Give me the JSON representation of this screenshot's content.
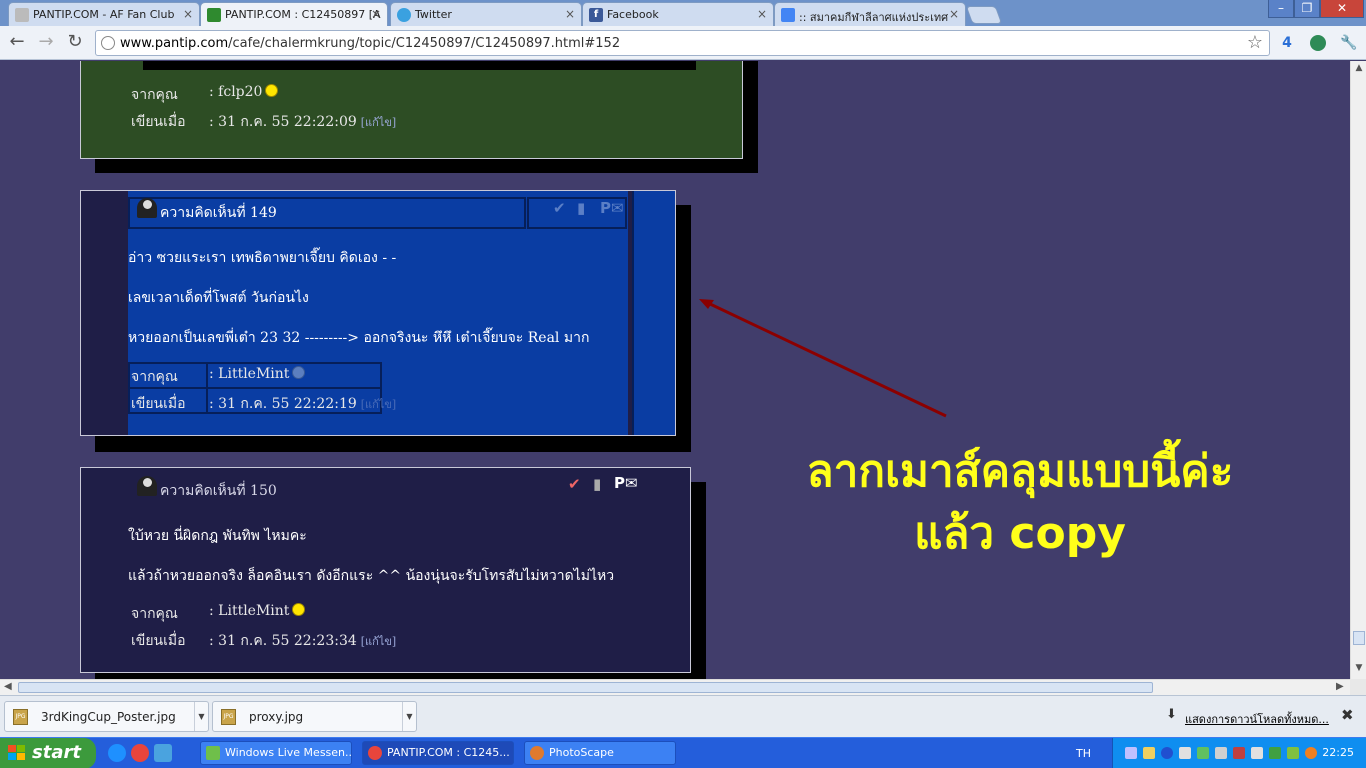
{
  "tabs": [
    {
      "title": "PANTIP.COM - AF Fan Club",
      "favicon": "pantip-icon"
    },
    {
      "title": "PANTIP.COM : C12450897 [A",
      "favicon": "pantip-cactus-icon"
    },
    {
      "title": "Twitter",
      "favicon": "twitter-icon"
    },
    {
      "title": "Facebook",
      "favicon": "facebook-icon"
    },
    {
      "title": ":: สมาคมกีฬาลีลาศแห่งประเทศ",
      "favicon": "google-icon"
    }
  ],
  "tab_close": "×",
  "window_controls": {
    "minimize": "–",
    "restore": "❐",
    "close": "✕"
  },
  "address_bar": {
    "domain": "www.pantip.com",
    "path": "/cafe/chalermkrung/topic/C12450897/C12450897.html#152"
  },
  "toolbar_icons": {
    "back": "←",
    "forward": "→",
    "reload": "↻",
    "ext_count": "4"
  },
  "post_prev": {
    "from_label": "จากคุณ",
    "from_value": ": fclp20",
    "written_label": "เขียนเมื่อ",
    "written_value": ": 31 ก.ค. 55 22:22:09",
    "edit": "[แก้ไข]"
  },
  "post_149": {
    "title": "ความคิดเห็นที่ 149",
    "lines": [
      "อ่าว ซวยแระเรา   เทพธิดาพยาเจี๊ยบ คิดเอง - -",
      "เลขเวลาเด็ดที่โพสต์ วันก่อนไง",
      "หวยออกเป็นเลขพี่เต๋า  23  32 ---------> ออกจริงนะ หึหึ เต๋าเจี๊ยบจะ Real มาก"
    ],
    "from_label": "จากคุณ",
    "from_value": ": LittleMint",
    "written_label": "เขียนเมื่อ",
    "written_value": ": 31 ก.ค. 55 22:22:19",
    "edit": "[แก้ไข]"
  },
  "post_150": {
    "title": "ความคิดเห็นที่ 150",
    "lines": [
      "ใบ้หวย นี่ผิดกฎ พันทิพ ไหมคะ",
      "แล้วถ้าหวยออกจริง  ล็อคอินเรา ดังอีกแระ ^^ น้องนุ่นจะรับโทรสับไม่หวาดไม่ไหว"
    ],
    "from_label": "จากคุณ",
    "from_value": ": LittleMint",
    "written_label": "เขียนเมื่อ",
    "written_value": ": 31 ก.ค. 55 22:23:34",
    "edit": "[แก้ไข]"
  },
  "annotation": {
    "line1": "ลากเมาส์คลุมแบบนี้ค่ะ",
    "line2": "แล้ว copy",
    "color": "#ffff1a",
    "arrow_color": "#8b0000"
  },
  "downloads": {
    "items": [
      "3rdKingCup_Poster.jpg",
      "proxy.jpg"
    ],
    "file_badge": "JPG",
    "show_all": "แสดงการดาวน์โหลดทั้งหมด...",
    "close": "✖"
  },
  "taskbar": {
    "start": "start",
    "tasks": [
      "Windows Live Messen...",
      "PANTIP.COM : C1245...",
      "PhotoScape"
    ],
    "language": "TH",
    "clock": "22:25"
  },
  "colors": {
    "page_bg": "#413d6b",
    "post_prev_bg": "#2d4d24",
    "post_149_bg": "#0a3da3",
    "post_150_bg": "#1f1e47"
  }
}
